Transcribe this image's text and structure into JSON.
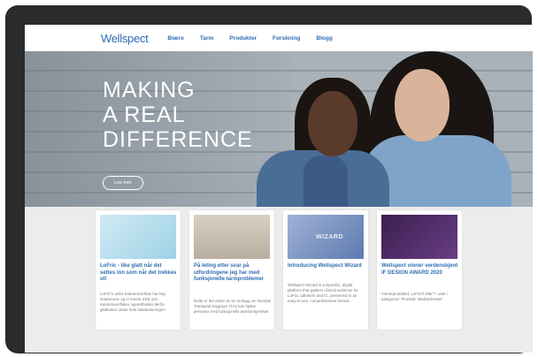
{
  "nav": {
    "logo": "Wellspect",
    "links": [
      "Blære",
      "Tarm",
      "Produkter",
      "Forskning",
      "Blogg"
    ]
  },
  "hero": {
    "title_lines": [
      "MAKING",
      "A REAL",
      "DIFFERENCE"
    ],
    "button": "Les mer"
  },
  "cards": [
    {
      "title": "LoFric - like glatt når det settes inn som når det trekkes ut!",
      "text": "LoFric's unike katetersverflate har høy smøreevne og er lenere med urin. Katetetoverflaten opprettholder derfor glattheten under hele kateteriseringen"
    },
    {
      "title": "På leting etter svar på utfordringene jeg har med funksjonelle tarmproblemer",
      "text": "Dette er det andre av tre innlegg om hvordan Transanal irrigasjon (TAI) kan hjelpe personer med funksjonelle tarmforstyrrelser."
    },
    {
      "title": "Introducing Wellspect Wizard",
      "image_label": "WIZARD",
      "text": "Wellspect Wizard is a dynamic, digital platform that gathers clinical evidence for LoFric catheters and IC, presented in an easy-to-use, comprehensive format."
    },
    {
      "title": "Wellspect vinner verdenskjent iF DESIGN AWARD 2020",
      "text": "Vinnerproduktet, LoFric® Elle™, vant i kategorien \"Produkt: Medisin/Helse\""
    }
  ]
}
